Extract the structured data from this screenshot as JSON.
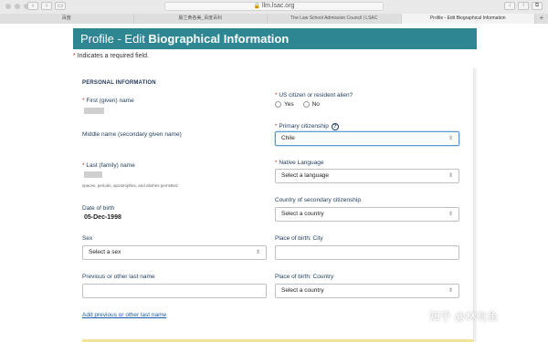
{
  "browser": {
    "url": "llm.lsac.org",
    "tabs": [
      "百度",
      "晨兰黄各美_百度百科",
      "The Law School Admission Council | LSAC",
      "Profile - Edit Biographical Information"
    ],
    "active_tab": 3
  },
  "page": {
    "title_normal": "Profile - Edit ",
    "title_bold": "Biographical Information",
    "required_note": "Indicates a required field.",
    "required_marker": "*",
    "section_title": "PERSONAL INFORMATION"
  },
  "form": {
    "first_name": {
      "label": "First (given) name"
    },
    "us_citizen": {
      "label": "US citizen or resident alien?",
      "options": [
        "Yes",
        "No"
      ]
    },
    "middle_name": {
      "label": "Middle name (secondary given name)"
    },
    "primary_citizenship": {
      "label": "Primary citizenship",
      "value": "Chile",
      "help": "?"
    },
    "last_name": {
      "label": "Last (family) name",
      "hint": "spaces, periods, apostrophes, and dashes permitted"
    },
    "native_language": {
      "label": "Native Language",
      "value": "Select a language"
    },
    "secondary_citizenship": {
      "label": "Country of secondary citizenship",
      "value": "Select a country"
    },
    "date_of_birth": {
      "label": "Date of birth",
      "value": "05-Dec-1998"
    },
    "sex": {
      "label": "Sex",
      "value": "Select a sex"
    },
    "birth_city": {
      "label": "Place of birth: City",
      "value": ""
    },
    "other_last_name": {
      "label": "Previous or other last name",
      "value": ""
    },
    "birth_country": {
      "label": "Place of birth: Country",
      "value": "Select a country"
    },
    "add_link": "Add previous or other last name"
  },
  "watermark": "知乎 @林有鱼",
  "colors": {
    "header": "#2d8692",
    "required": "#d12a2a",
    "link": "#1a5ca8",
    "label": "#1d3a5c"
  }
}
